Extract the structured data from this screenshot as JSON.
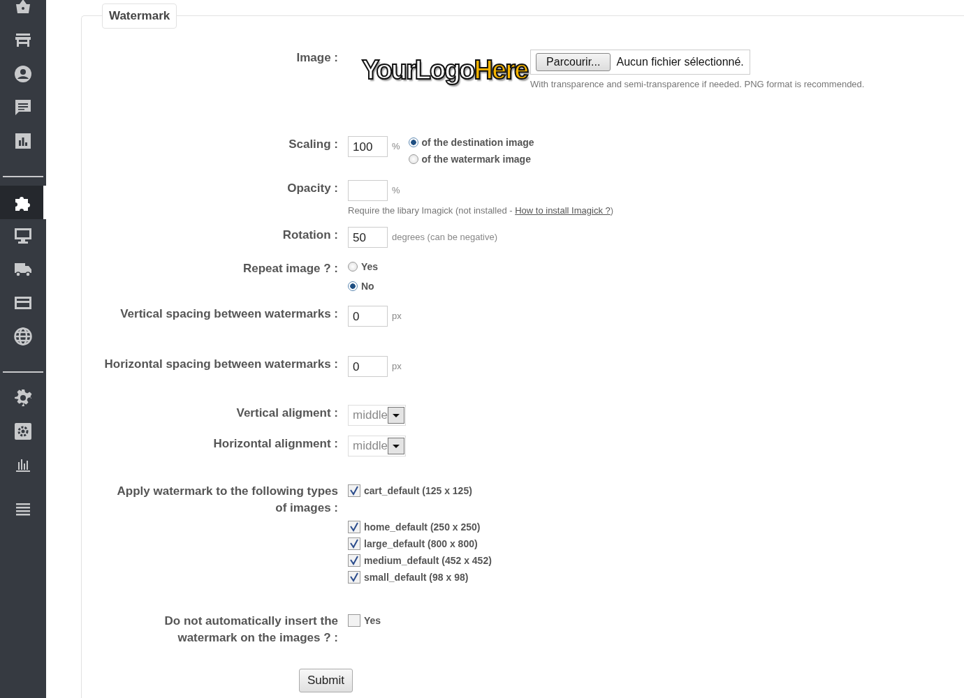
{
  "sidebar": {
    "groups": [
      {
        "items": [
          {
            "selected": false
          },
          {
            "selected": false
          },
          {
            "selected": false
          },
          {
            "selected": false
          },
          {
            "selected": false
          }
        ]
      },
      {
        "items": [
          {
            "selected": true
          },
          {
            "selected": false
          },
          {
            "selected": false
          },
          {
            "selected": false
          },
          {
            "selected": false
          }
        ]
      },
      {
        "items": [
          {
            "selected": false
          },
          {
            "selected": false
          },
          {
            "selected": false
          },
          {
            "selected": false
          }
        ]
      }
    ]
  },
  "fieldset": {
    "legend": "Watermark"
  },
  "fields": [
    {
      "kind": "image",
      "label": "Image :",
      "logo": [
        "YourLogo",
        "Here"
      ],
      "file_button": "Parcourir...",
      "file_status": "Aucun fichier sélectionné.",
      "help": "With transparence and semi-transparence if needed. PNG format is recommended."
    },
    {
      "kind": "scaling",
      "label": "Scaling :",
      "value": "100",
      "unit": "%",
      "options": [
        {
          "label": "of the destination image",
          "selected": true
        },
        {
          "label": "of the watermark image",
          "selected": false
        }
      ]
    },
    {
      "kind": "text",
      "label": "Opacity :",
      "unit": "%",
      "help": "Require the libary Imagick (not installed - ",
      "help_link": "How to install Imagick ?",
      "help_end": ")"
    },
    {
      "kind": "text",
      "label": "Rotation :",
      "value": "50",
      "unit": "degrees (can be negative)"
    },
    {
      "kind": "radio",
      "label": "Repeat image ? :",
      "options": [
        {
          "label": "Yes",
          "selected": false
        },
        {
          "label": "No",
          "selected": true
        }
      ]
    },
    {
      "kind": "text",
      "label": "Vertical spacing between watermarks :",
      "value": "0",
      "unit": "px"
    },
    {
      "kind": "text",
      "label": "Horizontal spacing between watermarks :",
      "value": "0",
      "unit": "px"
    },
    {
      "kind": "select",
      "label": "Vertical aligment :",
      "value": "middle"
    },
    {
      "kind": "select",
      "label": "Horizontal alignment :",
      "value": "middle"
    },
    {
      "kind": "checkboxes",
      "label": "Apply watermark to the following types of images :",
      "options": [
        {
          "label": "cart_default (125 x 125)",
          "checked": true
        },
        {
          "label": "home_default (250 x 250)",
          "checked": true
        },
        {
          "label": "large_default (800 x 800)",
          "checked": true
        },
        {
          "label": "medium_default (452 x 452)",
          "checked": true
        },
        {
          "label": "small_default (98 x 98)",
          "checked": true
        }
      ]
    },
    {
      "kind": "checkboxes",
      "label": "Do not automatically insert the watermark on the images ? :",
      "options": [
        {
          "label": "Yes",
          "checked": false
        }
      ]
    }
  ],
  "submit": "Submit"
}
